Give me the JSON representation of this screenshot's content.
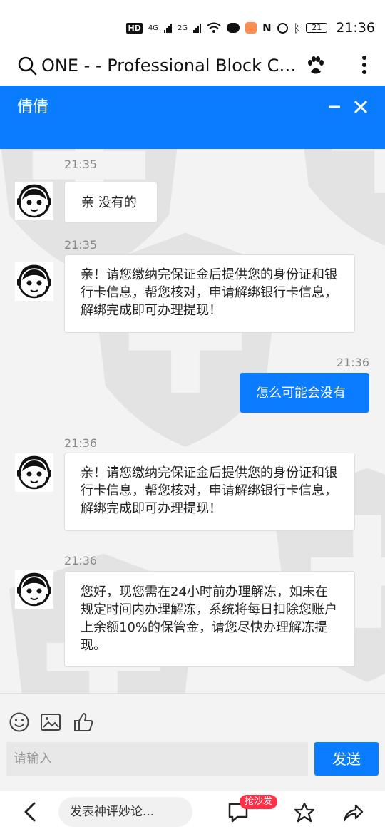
{
  "status_bar": {
    "time": "21:36",
    "network_1": "4G",
    "network_2": "2G",
    "battery": "21",
    "hd": "HD"
  },
  "browser_bar": {
    "title": "ONE - - Professional Block Ch..."
  },
  "chat_header": {
    "name": "倩倩"
  },
  "messages": [
    {
      "time": "21:35",
      "text": "亲 没有的"
    },
    {
      "time": "21:35",
      "text": "亲！请您缴纳完保证金后提供您的身份证和银行卡信息，帮您核对，申请解绑银行卡信息，解绑完成即可办理提现！"
    },
    {
      "time": "21:36",
      "text": "怎么可能会没有"
    },
    {
      "time": "21:36",
      "text": "亲！请您缴纳完保证金后提供您的身份证和银行卡信息，帮您核对，申请解绑银行卡信息，解绑完成即可办理提现！"
    },
    {
      "time": "21:36",
      "text": "您好，现您需在24小时前办理解冻，如未在规定时间内办理解冻，系统将每日扣除您账户上余额10%的保管金，请您尽快办理解冻提现。"
    }
  ],
  "input": {
    "placeholder": "请输入",
    "value": "",
    "send_label": "发送"
  },
  "bottom_bar": {
    "comment_placeholder": "发表神评妙论...",
    "badge": "抢沙发"
  },
  "colors": {
    "brand_blue": "#0a7cff",
    "chat_background": "#f3f3f3",
    "bubble_border": "#dddddd",
    "badge_red": "#ff3048"
  }
}
